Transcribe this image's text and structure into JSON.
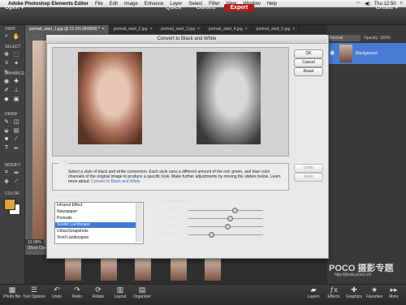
{
  "menubar": {
    "apple": "",
    "app_name": "Adobe Photoshop Elements Editor",
    "items": [
      "File",
      "Edit",
      "Image",
      "Enhance",
      "Layer",
      "Select",
      "Filter",
      "View",
      "Window",
      "Help"
    ],
    "clock": "Thu 12:50"
  },
  "toolbar": {
    "open_label": "Open ▾",
    "modes": [
      "Quick",
      "Guided",
      "Expert"
    ],
    "active_mode": "Expert",
    "create_label": "Create ▾"
  },
  "tools": {
    "sections": [
      "VIEW",
      "SELECT",
      "ENHANCE",
      "DRAW",
      "MODIFY",
      "COLOR"
    ],
    "foreground_color": "#e0a040",
    "background_color": "#ffffff"
  },
  "doc_tabs": [
    {
      "label": "portrait_start_1.jpg @ 12.1% (RGB/8) *"
    },
    {
      "label": "portrait_start_2.jpg"
    },
    {
      "label": "portrait_start_3.jpg"
    },
    {
      "label": "portrait_start_4.jpg"
    },
    {
      "label": "portrait_start_5.jpg"
    }
  ],
  "status": {
    "zoom": "12.08%",
    "show_open": "Show Open"
  },
  "layers": {
    "blend_mode": "Normal",
    "opacity_label": "Opacity: 100%",
    "layer_name": "Background"
  },
  "dialog": {
    "title": "Convert to Black and White",
    "before_label": "Before",
    "after_label": "After",
    "buttons": {
      "ok": "OK",
      "cancel": "Cancel",
      "reset": "Reset",
      "undo": "Undo",
      "redo": "Redo"
    },
    "tip_title": "Tip",
    "tip_text": "Select a style of black and white conversion. Each style uses a different amount of the red, green, and blue color channels of the original image to produce a specific look. Make further adjustments by moving the sliders below. Learn more about:",
    "tip_link": "Convert to Black and White",
    "style_label": "Select a style:",
    "styles": [
      "Infrared Effect",
      "Newspaper",
      "Portraits",
      "Scenic Landscape",
      "Urban/Snapshots",
      "Vivid Landscapes"
    ],
    "selected_style": "Scenic Landscape",
    "adjust_label": "Adjust Intensity:",
    "sliders": [
      {
        "label": "Red:",
        "value": 0.62
      },
      {
        "label": "Green:",
        "value": 0.55
      },
      {
        "label": "Blue:",
        "value": 0.52
      },
      {
        "label": "Contrast:",
        "value": 0.3
      }
    ]
  },
  "bottom_bar": {
    "left": [
      "Photo Bin",
      "Tool Options",
      "Undo",
      "Redo",
      "Rotate",
      "Layout",
      "Organizer"
    ],
    "right": [
      "Layers",
      "Effects",
      "Graphics",
      "Favorites",
      "More"
    ]
  },
  "watermark": {
    "logo": "POCO 摄影专题",
    "url": "http://photo.poco.cn/"
  }
}
